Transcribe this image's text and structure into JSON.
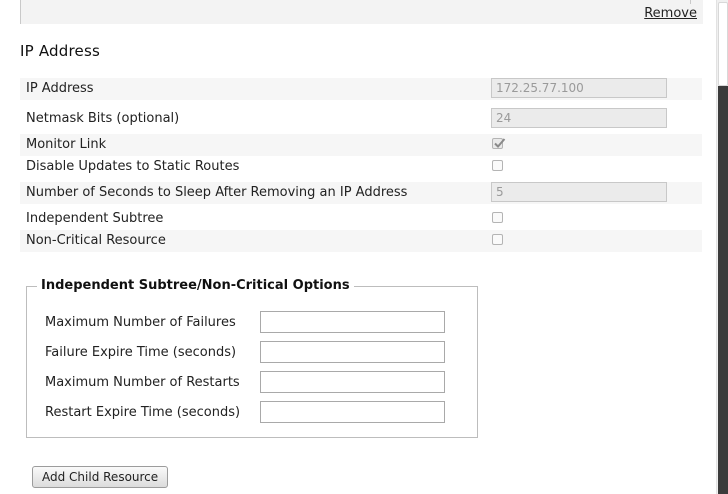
{
  "top_panel": {
    "remove_label": "Remove"
  },
  "section": {
    "title": "IP Address"
  },
  "fields": {
    "ip_address": {
      "label": "IP Address",
      "value": "172.25.77.100"
    },
    "netmask": {
      "label": "Netmask Bits (optional)",
      "value": "24"
    },
    "monitor_link": {
      "label": "Monitor Link",
      "checked": true
    },
    "disable_updates": {
      "label": "Disable Updates to Static Routes",
      "checked": false
    },
    "sleep_seconds": {
      "label": "Number of Seconds to Sleep After Removing an IP Address",
      "value": "5"
    },
    "independent_subtree": {
      "label": "Independent Subtree",
      "checked": false
    },
    "non_critical": {
      "label": "Non-Critical Resource",
      "checked": false
    }
  },
  "options": {
    "legend": "Independent Subtree/Non-Critical Options",
    "max_failures": {
      "label": "Maximum Number of Failures",
      "value": ""
    },
    "failure_expire": {
      "label": "Failure Expire Time (seconds)",
      "value": ""
    },
    "max_restarts": {
      "label": "Maximum Number of Restarts",
      "value": ""
    },
    "restart_expire": {
      "label": "Restart Expire Time (seconds)",
      "value": ""
    }
  },
  "actions": {
    "add_child_label": "Add Child Resource"
  }
}
